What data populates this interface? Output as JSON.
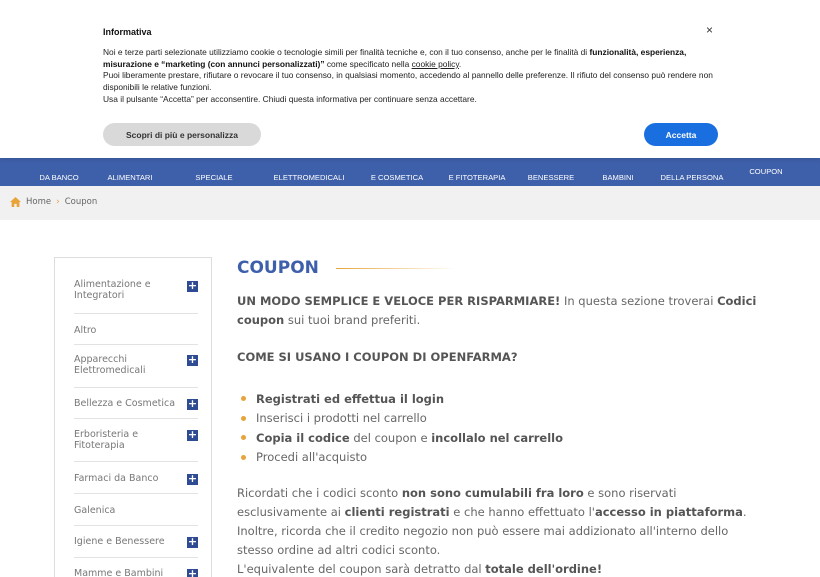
{
  "cookie": {
    "title": "Informativa",
    "close": "×",
    "p1_a": "Noi e terze parti selezionate utilizziamo cookie o tecnologie simili per finalità tecniche e, con il tuo consenso, anche per le finalità di ",
    "p1_b": "funzionalità, esperienza, misurazione e “marketing (con annunci personalizzati)”",
    "p1_c": " come specificato nella ",
    "p1_link": "cookie policy",
    "p1_d": ".",
    "p2": "Puoi liberamente prestare, rifiutare o revocare il tuo consenso, in qualsiasi momento, accedendo al pannello delle preferenze. Il rifiuto del consenso può rendere non disponibili le relative funzioni.",
    "p3": "Usa il pulsante “Accetta” per acconsentire. Chiudi questa informativa per continuare senza accettare.",
    "more_button": "Scopri di più e personalizza",
    "accept_button": "Accetta"
  },
  "nav": {
    "items": [
      {
        "l1": "",
        "l2": "DA BANCO"
      },
      {
        "l1": "",
        "l2": "ALIMENTARI"
      },
      {
        "l1": "",
        "l2": "SPECIALE"
      },
      {
        "l1": "",
        "l2": "ELETTROMEDICALI"
      },
      {
        "l1": "",
        "l2": "E COSMETICA"
      },
      {
        "l1": "",
        "l2": "E FITOTERAPIA"
      },
      {
        "l1": "",
        "l2": "BENESSERE"
      },
      {
        "l1": "",
        "l2": "BAMBINI"
      },
      {
        "l1": "",
        "l2": "DELLA PERSONA"
      },
      {
        "l1": "",
        "l2": "COUPON"
      }
    ]
  },
  "breadcrumb": {
    "home": "Home",
    "separator": "›",
    "current": "Coupon"
  },
  "sidebar": {
    "items": [
      {
        "label": "Alimentazione e Integratori",
        "expandable": true
      },
      {
        "label": "Altro",
        "expandable": false
      },
      {
        "label": "Apparecchi Elettromedicali",
        "expandable": true
      },
      {
        "label": "Bellezza e Cosmetica",
        "expandable": true
      },
      {
        "label": "Erboristeria e Fitoterapia",
        "expandable": true
      },
      {
        "label": "Farmaci da Banco",
        "expandable": true
      },
      {
        "label": "Galenica",
        "expandable": false
      },
      {
        "label": "Igiene e Benessere",
        "expandable": true
      },
      {
        "label": "Mamme e Bambini",
        "expandable": true
      }
    ],
    "plus_symbol": "+"
  },
  "main": {
    "title": "COUPON",
    "intro_bold": "UN MODO SEMPLICE E VELOCE PER RISPARMIARE!",
    "intro_text": " In questa sezione troverai ",
    "intro_bold2": "Codici coupon",
    "intro_text2": " sui tuoi brand preferiti.",
    "howto": "COME SI USANO I COUPON DI OPENFARMA?",
    "steps": [
      {
        "bold": "Registrati ed effettua il login",
        "text": "",
        "bold2": "",
        "text2": ""
      },
      {
        "bold": "",
        "text": "Inserisci i prodotti nel carrello",
        "bold2": "",
        "text2": ""
      },
      {
        "bold": "Copia il codice",
        "text": " del coupon e ",
        "bold2": "incollalo nel carrello",
        "text2": ""
      },
      {
        "bold": "",
        "text": "Procedi all'acquisto",
        "bold2": "",
        "text2": ""
      }
    ],
    "note_1": "Ricordati che i codici sconto ",
    "note_2": "non sono cumulabili fra loro",
    "note_3": " e sono riservati esclusivamente ai ",
    "note_4": "clienti registrati",
    "note_5": " e che hanno effettuato l'",
    "note_6": "accesso in piattaforma",
    "note_7": ".",
    "note_8": "Inoltre, ricorda che il credito negozio non può essere mai addizionato all'interno dello stesso ordine ad altri codici sconto.",
    "note_9": "L'equivalente del coupon sarà detratto dal ",
    "note_10": "totale dell'ordine!"
  }
}
